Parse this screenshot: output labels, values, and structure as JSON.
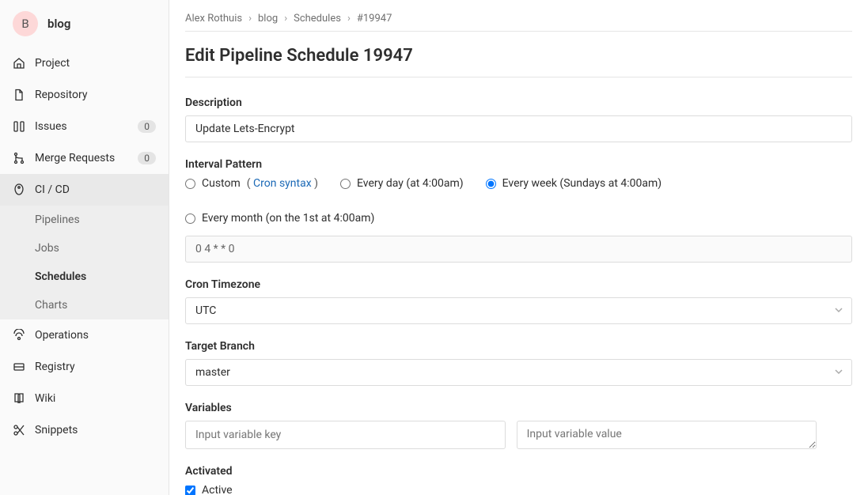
{
  "sidebar": {
    "avatar_letter": "B",
    "project_name": "blog",
    "items": [
      {
        "label": "Project"
      },
      {
        "label": "Repository"
      },
      {
        "label": "Issues",
        "badge": "0"
      },
      {
        "label": "Merge Requests",
        "badge": "0"
      },
      {
        "label": "CI / CD"
      },
      {
        "label": "Operations"
      },
      {
        "label": "Registry"
      },
      {
        "label": "Wiki"
      },
      {
        "label": "Snippets"
      }
    ],
    "cicd_sub": [
      {
        "label": "Pipelines"
      },
      {
        "label": "Jobs"
      },
      {
        "label": "Schedules"
      },
      {
        "label": "Charts"
      }
    ]
  },
  "breadcrumb": {
    "user": "Alex Rothuis",
    "project": "blog",
    "section": "Schedules",
    "id": "#19947"
  },
  "page_title": "Edit Pipeline Schedule 19947",
  "form": {
    "description_label": "Description",
    "description_value": "Update Lets-Encrypt",
    "interval_label": "Interval Pattern",
    "interval_options": {
      "custom": "Custom",
      "cron_link": "Cron syntax",
      "daily": "Every day (at 4:00am)",
      "weekly": "Every week (Sundays at 4:00am)",
      "monthly": "Every month (on the 1st at 4:00am)"
    },
    "cron_value": "0 4 * * 0",
    "timezone_label": "Cron Timezone",
    "timezone_value": "UTC",
    "branch_label": "Target Branch",
    "branch_value": "master",
    "variables_label": "Variables",
    "var_key_placeholder": "Input variable key",
    "var_value_placeholder": "Input variable value",
    "activated_label": "Activated",
    "active_label": "Active"
  }
}
